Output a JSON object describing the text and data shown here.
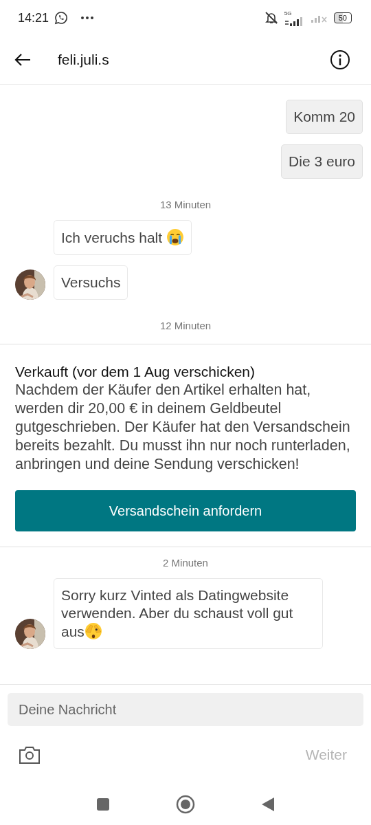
{
  "status_bar": {
    "time": "14:21",
    "network": "5G",
    "battery": "50"
  },
  "header": {
    "title": "feli.juli.s"
  },
  "messages": [
    {
      "kind": "sent",
      "text": "Komm 20"
    },
    {
      "kind": "sent",
      "text": "Die 3 euro"
    },
    {
      "kind": "timestamp",
      "text": "13 Minuten"
    },
    {
      "kind": "received",
      "text": "Ich veruchs halt",
      "emoji": {
        "kind": "crying"
      },
      "avatar": false
    },
    {
      "kind": "received",
      "text": "Versuchs",
      "avatar": true
    },
    {
      "kind": "timestamp",
      "text": "12 Minuten"
    },
    {
      "kind": "order_card",
      "title": "Verkauft (vor dem 1 Aug verschicken)",
      "body": "Nachdem der Käufer den Artikel erhalten hat, werden dir 20,00 € in deinem Geldbeutel gutgeschrieben. Der Käufer hat den Versandschein bereits bezahlt. Du musst ihn nur noch runterladen, anbringen und deine Sendung verschicken!",
      "button": "Versandschein anfordern"
    },
    {
      "kind": "timestamp",
      "text": "2 Minuten"
    },
    {
      "kind": "received",
      "text": "Sorry kurz Vinted als Datingwebsite verwenden. Aber du schaust voll gut aus",
      "emoji": {
        "kind": "peeking"
      },
      "avatar": true
    }
  ],
  "composer": {
    "placeholder": "Deine Nachricht",
    "send": "Weiter",
    "send_disabled": true
  }
}
